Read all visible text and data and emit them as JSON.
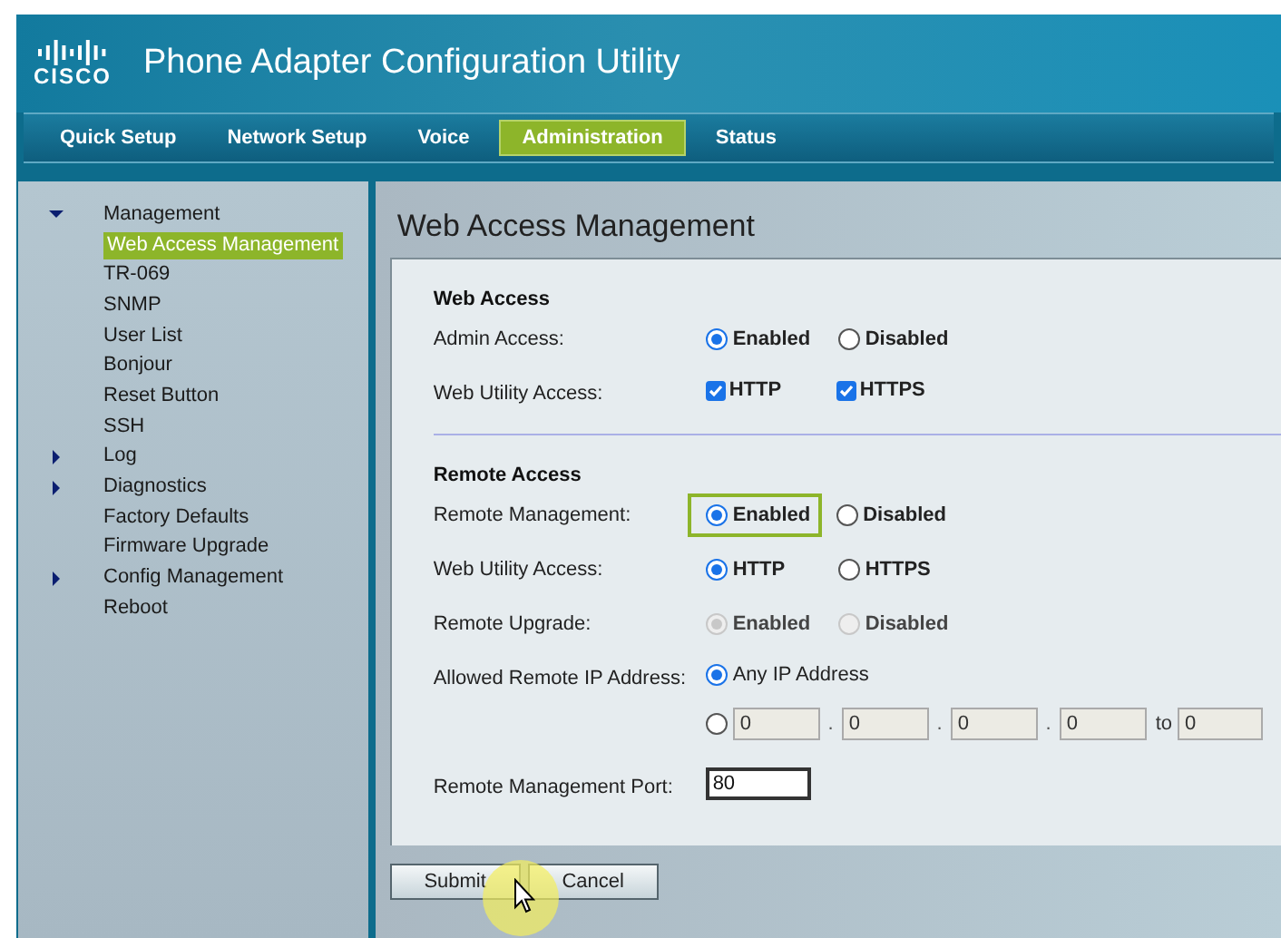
{
  "header": {
    "logo_text": "CISCO",
    "title": "Phone Adapter Configuration Utility"
  },
  "nav": [
    {
      "label": "Quick Setup",
      "selected": false
    },
    {
      "label": "Network Setup",
      "selected": false
    },
    {
      "label": "Voice",
      "selected": false
    },
    {
      "label": "Administration",
      "selected": true
    },
    {
      "label": "Status",
      "selected": false
    }
  ],
  "sidebar": [
    {
      "label": "Management",
      "expanded": true,
      "selected": false,
      "children": [
        {
          "label": "Web Access Management",
          "selected": true
        },
        {
          "label": "TR-069",
          "selected": false
        },
        {
          "label": "SNMP",
          "selected": false
        },
        {
          "label": "User List",
          "selected": false
        },
        {
          "label": "Bonjour",
          "selected": false
        },
        {
          "label": "Reset Button",
          "selected": false
        },
        {
          "label": "SSH",
          "selected": false
        }
      ]
    },
    {
      "label": "Log",
      "expanded": false,
      "selected": false
    },
    {
      "label": "Diagnostics",
      "expanded": false,
      "selected": false
    },
    {
      "label": "Factory Defaults",
      "selected": false
    },
    {
      "label": "Firmware Upgrade",
      "selected": false
    },
    {
      "label": "Config Management",
      "expanded": false,
      "selected": false
    },
    {
      "label": "Reboot",
      "selected": false
    }
  ],
  "page_title": "Web Access Management",
  "sections": [
    {
      "title": "Web Access",
      "rows": [
        {
          "kind": "radio",
          "label": "Admin Access:",
          "options": [
            {
              "label": "Enabled",
              "selected": true,
              "disabled": false,
              "highlighted": false
            },
            {
              "label": "Disabled",
              "selected": false,
              "disabled": false,
              "highlighted": false
            }
          ]
        },
        {
          "kind": "checkbox",
          "label": "Web Utility Access:",
          "options": [
            {
              "label": "HTTP",
              "checked": true
            },
            {
              "label": "HTTPS",
              "checked": true
            }
          ]
        }
      ]
    },
    {
      "title": "Remote Access",
      "rows": [
        {
          "kind": "radio",
          "label": "Remote Management:",
          "options": [
            {
              "label": "Enabled",
              "selected": true,
              "disabled": false,
              "highlighted": true
            },
            {
              "label": "Disabled",
              "selected": false,
              "disabled": false,
              "highlighted": false
            }
          ]
        },
        {
          "kind": "radio",
          "label": "Web Utility Access:",
          "options": [
            {
              "label": "HTTP",
              "selected": true,
              "disabled": false,
              "highlighted": false
            },
            {
              "label": "HTTPS",
              "selected": false,
              "disabled": false,
              "highlighted": false
            }
          ]
        },
        {
          "kind": "radio",
          "label": "Remote Upgrade:",
          "options": [
            {
              "label": "Enabled",
              "selected": true,
              "disabled": true,
              "highlighted": false
            },
            {
              "label": "Disabled",
              "selected": false,
              "disabled": true,
              "highlighted": false
            }
          ]
        },
        {
          "kind": "ip_choice",
          "label": "Allowed Remote IP Address:",
          "any_label": "Any IP Address",
          "any_selected": true,
          "octets": [
            "0",
            "0",
            "0",
            "0"
          ],
          "separator": ".",
          "to_label": "to",
          "to_value": "0"
        },
        {
          "kind": "text",
          "label": "Remote Management Port:",
          "value": "80"
        }
      ]
    }
  ],
  "buttons": [
    "Submit",
    "Cancel"
  ]
}
